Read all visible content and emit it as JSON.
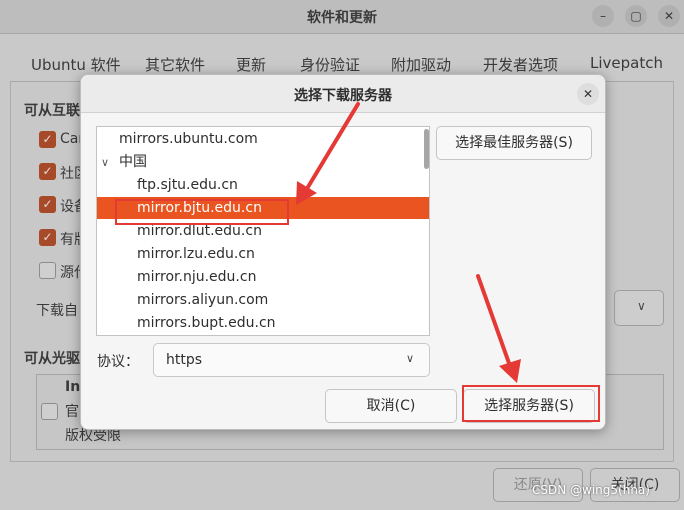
{
  "window": {
    "title": "软件和更新",
    "controls": {
      "minimize": "–",
      "maximize": "▢",
      "close": "✕"
    },
    "tabs": [
      "Ubuntu 软件",
      "其它软件",
      "更新",
      "身份验证",
      "附加驱动",
      "开发者选项",
      "Livepatch"
    ],
    "section_internet": "可从互联",
    "checkboxes": [
      {
        "label": "Can",
        "checked": true
      },
      {
        "label": "社区",
        "checked": true
      },
      {
        "label": "设备",
        "checked": true
      },
      {
        "label": "有版",
        "checked": true
      },
      {
        "label": "源代",
        "checked": false
      }
    ],
    "download_from": "下载自",
    "section_cdrom": "可从光驱",
    "install_title": "Ins",
    "install_line1": "官",
    "install_line2": "版权受限",
    "buttons": {
      "revert": "还原(V)",
      "close": "关闭(C)"
    },
    "watermark": "CSDN @wing5(hha)"
  },
  "dialog": {
    "title": "选择下载服务器",
    "close_icon": "✕",
    "servers": [
      {
        "label": "mirrors.ubuntu.com",
        "indent": 0,
        "selected": false,
        "expander": false
      },
      {
        "label": "中国",
        "indent": 0,
        "selected": false,
        "expander": true,
        "expander_glyph": "∨"
      },
      {
        "label": "ftp.sjtu.edu.cn",
        "indent": 1,
        "selected": false,
        "expander": false
      },
      {
        "label": "mirror.bjtu.edu.cn",
        "indent": 1,
        "selected": true,
        "expander": false
      },
      {
        "label": "mirror.dlut.edu.cn",
        "indent": 1,
        "selected": false,
        "expander": false
      },
      {
        "label": "mirror.lzu.edu.cn",
        "indent": 1,
        "selected": false,
        "expander": false
      },
      {
        "label": "mirror.nju.edu.cn",
        "indent": 1,
        "selected": false,
        "expander": false
      },
      {
        "label": "mirrors.aliyun.com",
        "indent": 1,
        "selected": false,
        "expander": false
      },
      {
        "label": "mirrors.bupt.edu.cn",
        "indent": 1,
        "selected": false,
        "expander": false
      }
    ],
    "best_server_button": "选择最佳服务器(S)",
    "protocol_label": "协议：",
    "protocol_value": "https",
    "cancel_button": "取消(C)",
    "choose_button": "选择服务器(S)",
    "selection_color": "#e95420",
    "annotation_color": "#e53935"
  }
}
